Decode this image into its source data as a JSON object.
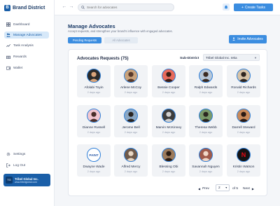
{
  "brand": {
    "name": "Brand District",
    "logo_letter": "B"
  },
  "sidebar": {
    "items": [
      {
        "label": "Dashboard",
        "icon": "grid-icon",
        "active": false
      },
      {
        "label": "Manage Advocates",
        "icon": "users-icon",
        "active": true
      },
      {
        "label": "Task Analysis",
        "icon": "trend-icon",
        "active": false
      },
      {
        "label": "Rewards",
        "icon": "gift-icon",
        "active": false
      },
      {
        "label": "Wallet",
        "icon": "wallet-icon",
        "active": false
      }
    ],
    "bottom": [
      {
        "label": "Settings",
        "icon": "gear-icon"
      },
      {
        "label": "Log Out",
        "icon": "logout-icon"
      }
    ],
    "org": {
      "name": "Tribel Global Inc.",
      "email": "www.tribelglobal.com"
    }
  },
  "topbar": {
    "search_placeholder": "Search for advocates",
    "create_label": "Create Tasks"
  },
  "header": {
    "title": "Manage Advocates",
    "subtitle": "Accept requests, and strengthen your brand's influence with engaged advocates.",
    "tabs": [
      {
        "label": "Pending Requests",
        "active": true
      },
      {
        "label": "All Advocates",
        "active": false
      }
    ],
    "invite_label": "Invite Advocates"
  },
  "panel": {
    "title": "Advocates Requests (75)",
    "subdistrict_label": "Sub-District",
    "subdistrict_value": "Tribel Global Inc. Ieka"
  },
  "advocates": [
    {
      "name": "Afolabi Toyin",
      "time": "2 days ago",
      "bg": "#2b2b2b",
      "fg": "#d9a47a"
    },
    {
      "name": "Arlene McCoy",
      "time": "2 days ago",
      "bg": "#c9a27b",
      "fg": "#5a3a2a"
    },
    {
      "name": "Bessie Cooper",
      "time": "2 days ago",
      "bg": "#e86a5c",
      "fg": "#3a1e16"
    },
    {
      "name": "Ralph Edwards",
      "time": "2 days ago",
      "bg": "#b7c7d8",
      "fg": "#3b2b22"
    },
    {
      "name": "Ronald Richards",
      "time": "2 days ago",
      "bg": "#d7c3a7",
      "fg": "#2f2620"
    },
    {
      "name": "Dianne Russell",
      "time": "2 days ago",
      "bg": "#f2c7d0",
      "fg": "#4a2f2a"
    },
    {
      "name": "Jerome Bell",
      "time": "2 days ago",
      "bg": "#8aa7c4",
      "fg": "#2a2420"
    },
    {
      "name": "Marvin McKinney",
      "time": "2 days ago",
      "bg": "#3d3d3d",
      "fg": "#d0d0d0"
    },
    {
      "name": "Theresa Webb",
      "time": "2 days ago",
      "bg": "#7a9a6a",
      "fg": "#2b2620"
    },
    {
      "name": "Darrell Steward",
      "time": "2 days ago",
      "bg": "#c98a5a",
      "fg": "#2a1a14"
    },
    {
      "name": "Dwayne Wade",
      "time": "2 days ago",
      "bg": "#ffffff",
      "fg": "#2b5aa8",
      "badge": "PAINT"
    },
    {
      "name": "Alfred Mercy",
      "time": "2 days ago",
      "bg": "#6f5a4a",
      "fg": "#e8d7c4"
    },
    {
      "name": "Blessing Obi",
      "time": "2 days ago",
      "bg": "#9d7b5c",
      "fg": "#2a1c14"
    },
    {
      "name": "Savannah Nguyen",
      "time": "2 days ago",
      "bg": "#a15a4a",
      "fg": "#f1d8c8"
    },
    {
      "name": "Kristin Watson",
      "time": "2 days ago",
      "bg": "#141414",
      "fg": "#e50914",
      "badge": "N"
    }
  ],
  "pagination": {
    "prev_label": "Prev",
    "next_label": "Next",
    "current_page": "2",
    "of_label": "of 5"
  },
  "colors": {
    "accent": "#3b8de0",
    "brand": "#1a5fa8",
    "active_nav": "#d6e8f9"
  }
}
